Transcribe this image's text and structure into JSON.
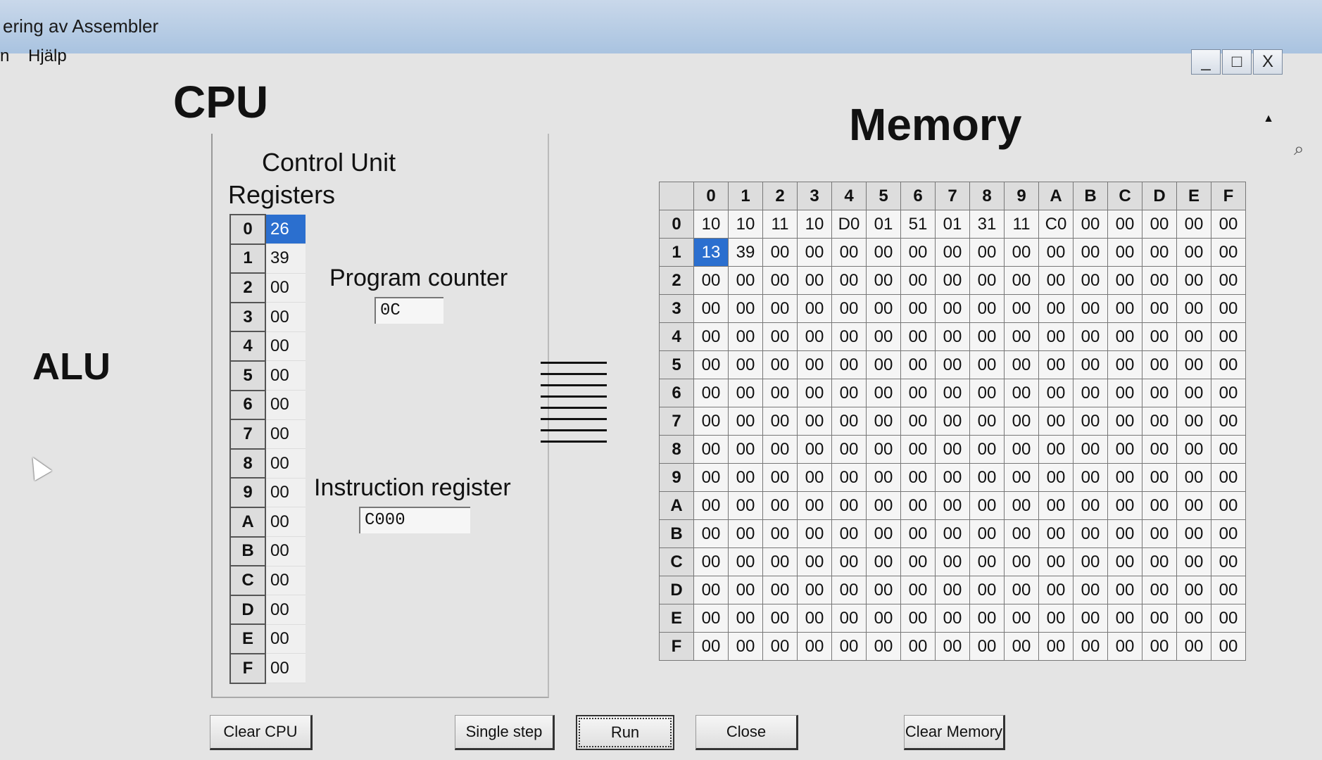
{
  "window": {
    "title": "ering av Assembler"
  },
  "menu": [
    {
      "label": "n"
    },
    {
      "label": "Hjälp"
    }
  ],
  "window_buttons": [
    {
      "symbol": "_"
    },
    {
      "symbol": "□"
    },
    {
      "symbol": "X"
    }
  ],
  "cpu": {
    "title": "CPU",
    "alu_label": "ALU",
    "control_unit_label": "Control Unit",
    "registers_label": "Registers",
    "registers": [
      {
        "index": "0",
        "value": "26",
        "selected": true
      },
      {
        "index": "1",
        "value": "39"
      },
      {
        "index": "2",
        "value": "00"
      },
      {
        "index": "3",
        "value": "00"
      },
      {
        "index": "4",
        "value": "00"
      },
      {
        "index": "5",
        "value": "00"
      },
      {
        "index": "6",
        "value": "00"
      },
      {
        "index": "7",
        "value": "00"
      },
      {
        "index": "8",
        "value": "00"
      },
      {
        "index": "9",
        "value": "00"
      },
      {
        "index": "A",
        "value": "00"
      },
      {
        "index": "B",
        "value": "00"
      },
      {
        "index": "C",
        "value": "00"
      },
      {
        "index": "D",
        "value": "00"
      },
      {
        "index": "E",
        "value": "00"
      },
      {
        "index": "F",
        "value": "00"
      }
    ],
    "program_counter": {
      "label": "Program counter",
      "value": "0C"
    },
    "instruction_register": {
      "label": "Instruction register",
      "value": "C000"
    }
  },
  "memory": {
    "title": "Memory",
    "columns": [
      "0",
      "1",
      "2",
      "3",
      "4",
      "5",
      "6",
      "7",
      "8",
      "9",
      "A",
      "B",
      "C",
      "D",
      "E",
      "F"
    ],
    "rows": [
      {
        "label": "0",
        "cells": [
          "10",
          "10",
          "11",
          "10",
          "D0",
          "01",
          "51",
          "01",
          "31",
          "11",
          "C0",
          "00",
          "00",
          "00",
          "00",
          "00"
        ]
      },
      {
        "label": "1",
        "cells": [
          "13",
          "39",
          "00",
          "00",
          "00",
          "00",
          "00",
          "00",
          "00",
          "00",
          "00",
          "00",
          "00",
          "00",
          "00",
          "00"
        ],
        "selected_col": 0
      },
      {
        "label": "2",
        "cells": [
          "00",
          "00",
          "00",
          "00",
          "00",
          "00",
          "00",
          "00",
          "00",
          "00",
          "00",
          "00",
          "00",
          "00",
          "00",
          "00"
        ]
      },
      {
        "label": "3",
        "cells": [
          "00",
          "00",
          "00",
          "00",
          "00",
          "00",
          "00",
          "00",
          "00",
          "00",
          "00",
          "00",
          "00",
          "00",
          "00",
          "00"
        ]
      },
      {
        "label": "4",
        "cells": [
          "00",
          "00",
          "00",
          "00",
          "00",
          "00",
          "00",
          "00",
          "00",
          "00",
          "00",
          "00",
          "00",
          "00",
          "00",
          "00"
        ]
      },
      {
        "label": "5",
        "cells": [
          "00",
          "00",
          "00",
          "00",
          "00",
          "00",
          "00",
          "00",
          "00",
          "00",
          "00",
          "00",
          "00",
          "00",
          "00",
          "00"
        ]
      },
      {
        "label": "6",
        "cells": [
          "00",
          "00",
          "00",
          "00",
          "00",
          "00",
          "00",
          "00",
          "00",
          "00",
          "00",
          "00",
          "00",
          "00",
          "00",
          "00"
        ]
      },
      {
        "label": "7",
        "cells": [
          "00",
          "00",
          "00",
          "00",
          "00",
          "00",
          "00",
          "00",
          "00",
          "00",
          "00",
          "00",
          "00",
          "00",
          "00",
          "00"
        ]
      },
      {
        "label": "8",
        "cells": [
          "00",
          "00",
          "00",
          "00",
          "00",
          "00",
          "00",
          "00",
          "00",
          "00",
          "00",
          "00",
          "00",
          "00",
          "00",
          "00"
        ]
      },
      {
        "label": "9",
        "cells": [
          "00",
          "00",
          "00",
          "00",
          "00",
          "00",
          "00",
          "00",
          "00",
          "00",
          "00",
          "00",
          "00",
          "00",
          "00",
          "00"
        ]
      },
      {
        "label": "A",
        "cells": [
          "00",
          "00",
          "00",
          "00",
          "00",
          "00",
          "00",
          "00",
          "00",
          "00",
          "00",
          "00",
          "00",
          "00",
          "00",
          "00"
        ]
      },
      {
        "label": "B",
        "cells": [
          "00",
          "00",
          "00",
          "00",
          "00",
          "00",
          "00",
          "00",
          "00",
          "00",
          "00",
          "00",
          "00",
          "00",
          "00",
          "00"
        ]
      },
      {
        "label": "C",
        "cells": [
          "00",
          "00",
          "00",
          "00",
          "00",
          "00",
          "00",
          "00",
          "00",
          "00",
          "00",
          "00",
          "00",
          "00",
          "00",
          "00"
        ]
      },
      {
        "label": "D",
        "cells": [
          "00",
          "00",
          "00",
          "00",
          "00",
          "00",
          "00",
          "00",
          "00",
          "00",
          "00",
          "00",
          "00",
          "00",
          "00",
          "00"
        ]
      },
      {
        "label": "E",
        "cells": [
          "00",
          "00",
          "00",
          "00",
          "00",
          "00",
          "00",
          "00",
          "00",
          "00",
          "00",
          "00",
          "00",
          "00",
          "00",
          "00"
        ]
      },
      {
        "label": "F",
        "cells": [
          "00",
          "00",
          "00",
          "00",
          "00",
          "00",
          "00",
          "00",
          "00",
          "00",
          "00",
          "00",
          "00",
          "00",
          "00",
          "00"
        ]
      }
    ]
  },
  "buttons": {
    "clear_cpu": "Clear CPU",
    "single_step": "Single step",
    "run": "Run",
    "close": "Close",
    "clear_memory": "Clear Memory"
  },
  "colors": {
    "selection": "#2b6fcf",
    "titlebar": "#a9c3e0"
  },
  "icons": {
    "scroll_up": "triangle-up-icon",
    "search": "magnifier-icon",
    "cursor": "mouse-pointer-icon"
  }
}
